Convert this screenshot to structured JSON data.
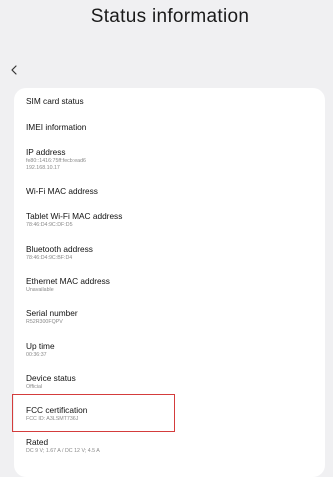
{
  "header": {
    "title": "Status information"
  },
  "icons": {
    "back": "chevron-left-icon"
  },
  "items": [
    {
      "label": "SIM card status",
      "sub": ""
    },
    {
      "label": "IMEI information",
      "sub": ""
    },
    {
      "label": "IP address",
      "sub": "fe80::1416:75ff:fecb:ead6",
      "sub2": "192.168.10.17"
    },
    {
      "label": "Wi-Fi MAC address",
      "sub": ""
    },
    {
      "label": "Tablet Wi-Fi MAC address",
      "sub": "78:46:D4:9C:DF:D5"
    },
    {
      "label": "Bluetooth address",
      "sub": "78:46:D4:9C:BF:D4"
    },
    {
      "label": "Ethernet MAC address",
      "sub": "Unavailable"
    },
    {
      "label": "Serial number",
      "sub": "R52R300FQPV"
    },
    {
      "label": "Up time",
      "sub": "00:36:37"
    },
    {
      "label": "Device status",
      "sub": "Official"
    },
    {
      "label": "FCC certification",
      "sub": "FCC ID: A3LSMT736J"
    },
    {
      "label": "Rated",
      "sub": "DC 9 V; 1.67 A / DC 12 V; 4.5 A"
    }
  ],
  "colors": {
    "background": "#f0f0f2",
    "card": "#ffffff",
    "highlight_border": "#d43c3c"
  }
}
